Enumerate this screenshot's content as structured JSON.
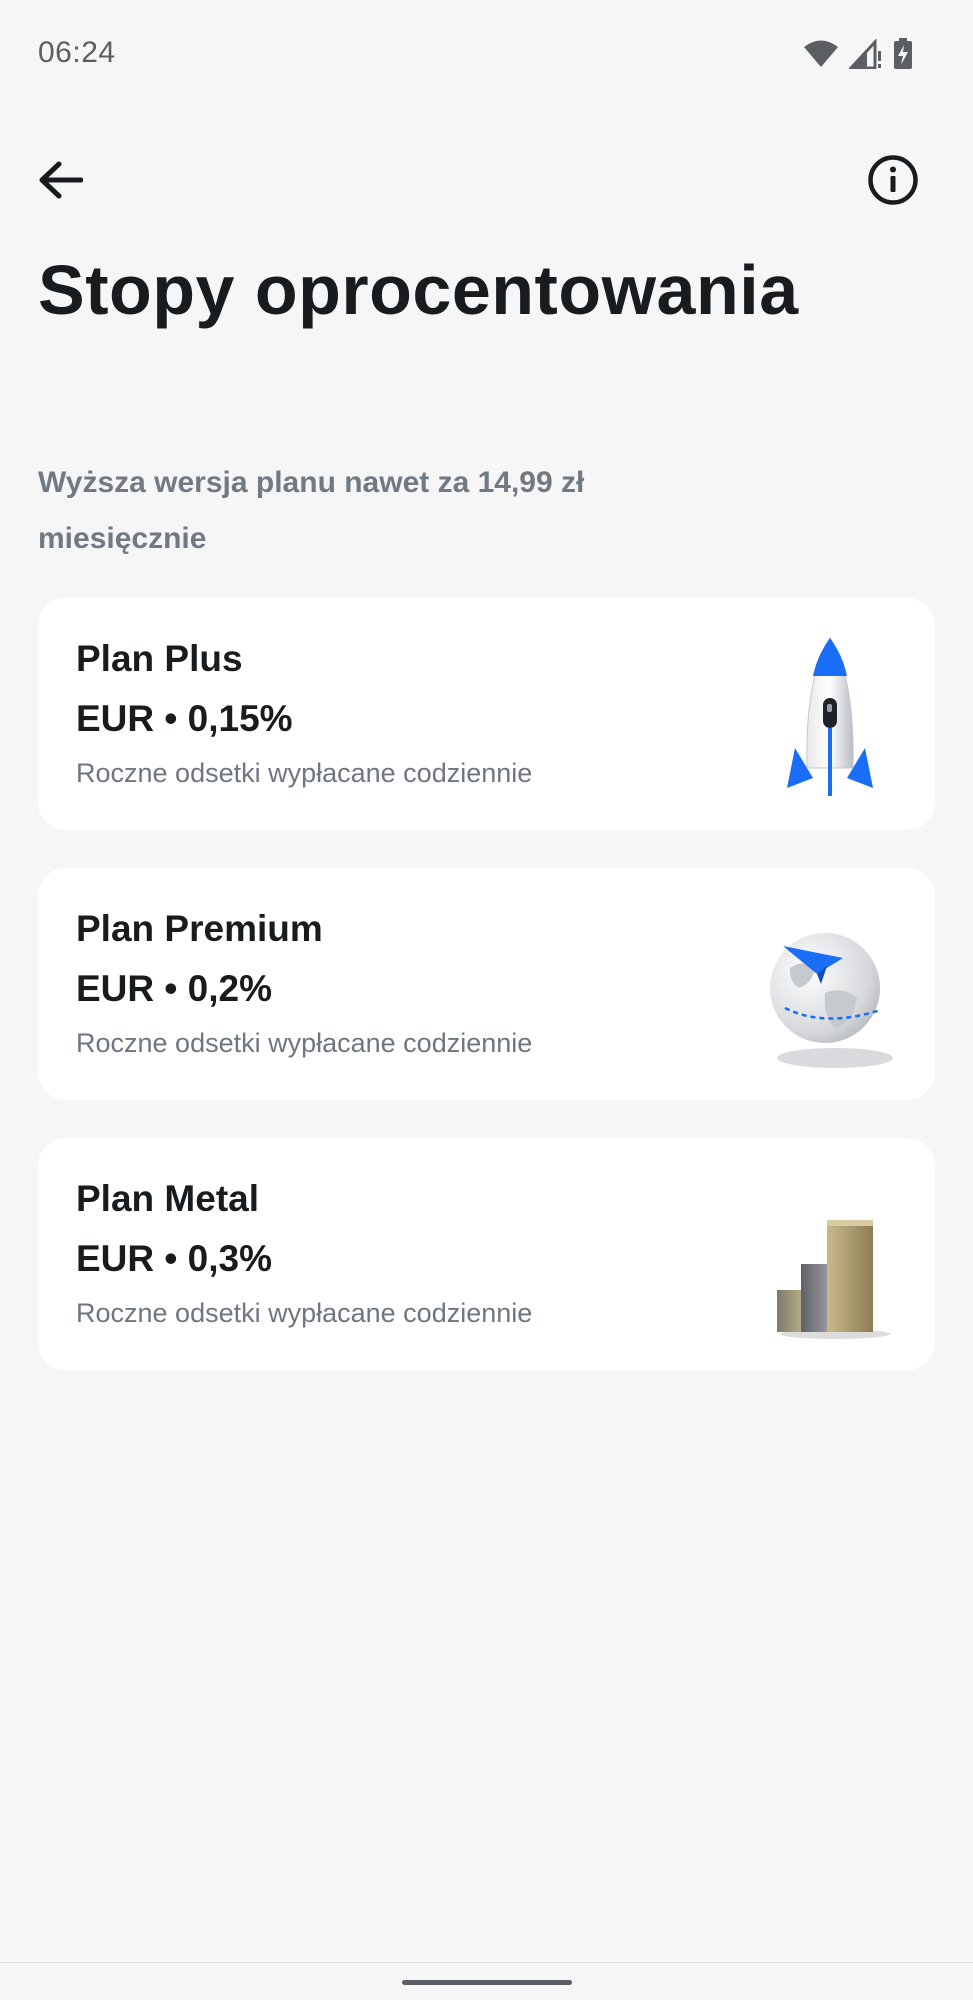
{
  "status_bar": {
    "time": "06:24",
    "icons": [
      "wifi-icon",
      "signal-icon",
      "battery-charging-icon"
    ]
  },
  "top_bar": {
    "back_icon": "arrow-left-icon",
    "info_icon": "info-circle-icon"
  },
  "page": {
    "title": "Stopy oprocentowania",
    "subtitle": "Wyższa wersja planu nawet za 14,99 zł miesięcznie"
  },
  "plans": [
    {
      "name": "Plan Plus",
      "rate": "EUR • 0,15%",
      "description": "Roczne odsetki wypłacane codziennie",
      "illustration": "rocket-icon"
    },
    {
      "name": "Plan Premium",
      "rate": "EUR • 0,2%",
      "description": "Roczne odsetki wypłacane codziennie",
      "illustration": "globe-plane-icon"
    },
    {
      "name": "Plan Metal",
      "rate": "EUR • 0,3%",
      "description": "Roczne odsetki wypłacane codziennie",
      "illustration": "metal-bars-icon"
    }
  ],
  "colors": {
    "background": "#f6f6f6",
    "card": "#ffffff",
    "text_primary": "#191c1f",
    "text_secondary": "#717a83",
    "accent_blue": "#1a6ef5"
  }
}
